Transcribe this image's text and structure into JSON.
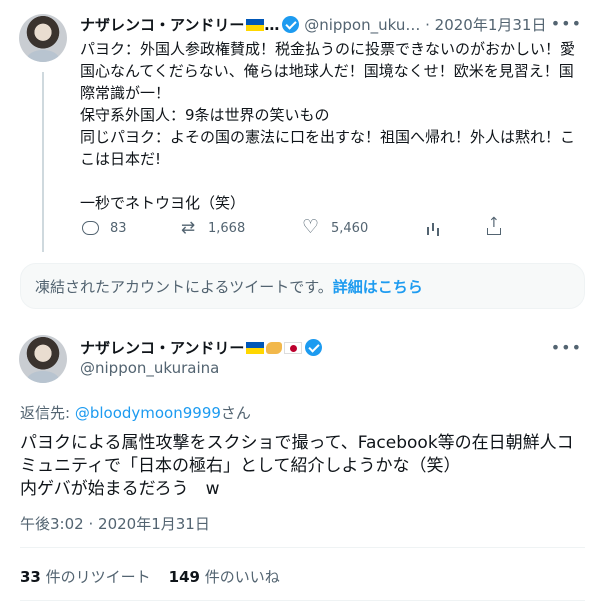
{
  "quoted_tweet": {
    "display_name": "ナザレンコ・アンドリー",
    "name_ellipsis": "…",
    "handle": "@nippon_uku…",
    "separator": "·",
    "date": "2020年1月31日",
    "more_icon": "more-horizontal-icon",
    "lines": [
      "パヨク：外国人参政権賛成！税金払うのに投票できないのがおかしい！愛",
      "国心なんてくだらない、俺らは地球人だ！国境なくせ！欧米を見習え！国",
      "際常識が一！",
      "保守系外国人：9条は世界の笑いもの",
      "同じパヨク：よその国の憲法に口を出すな！祖国へ帰れ！外人は黙れ！こ",
      "こは日本だ!",
      "",
      "一秒でネトウヨ化（笑）"
    ],
    "actions": {
      "reply_count": "83",
      "retweet_count": "1,668",
      "like_count": "5,460"
    }
  },
  "notice": {
    "text": "凍結されたアカウントによるツイートです。",
    "link_label": "詳細はこちら"
  },
  "main_tweet": {
    "display_name": "ナザレンコ・アンドリー",
    "handle": "@nippon_ukuraina",
    "replying_prefix": "返信先: ",
    "replying_to": "@bloodymoon9999",
    "replying_suffix": "さん",
    "body_lines": [
      "パヨクによる属性攻撃をスクショで撮って、Facebook等の在日朝鮮人コ",
      "ミュニティで「日本の極右」として紹介しようかな（笑）",
      "内ゲバが始まるだろう　w"
    ],
    "time": "午後3:02",
    "separator": "·",
    "date": "2020年1月31日",
    "retweet_count": "33",
    "retweet_label": " 件のリツイート",
    "like_count": "149",
    "like_label": " 件のいいね"
  },
  "colors": {
    "accent": "#1d9bf0",
    "muted": "#536471",
    "text": "#0f1419",
    "ukraine_blue": "#0057b7",
    "ukraine_yellow": "#ffd700"
  }
}
